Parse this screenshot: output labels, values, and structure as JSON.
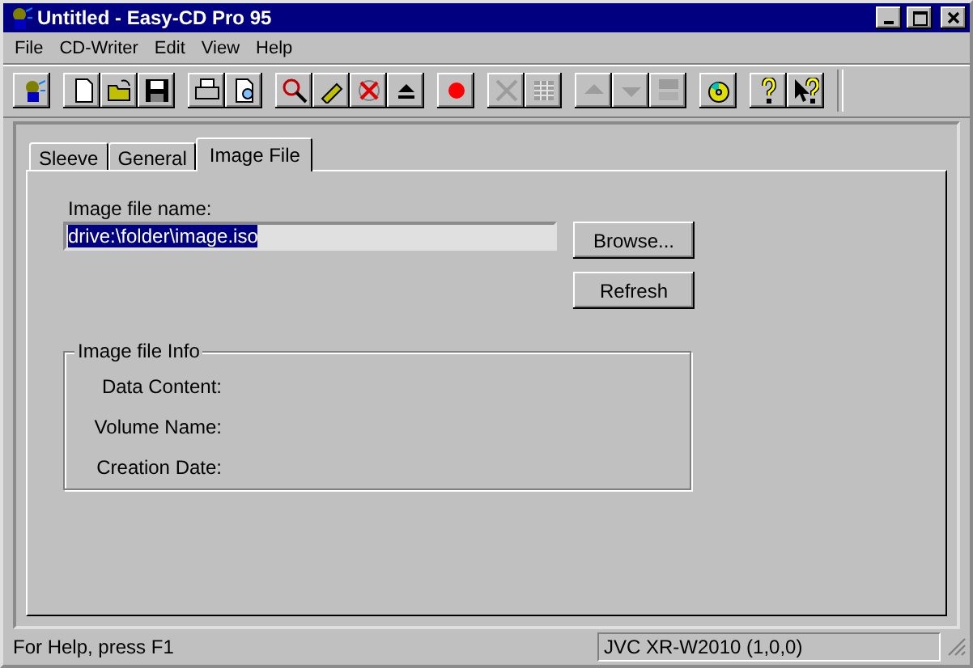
{
  "window": {
    "title": "Untitled - Easy-CD Pro 95"
  },
  "menu": [
    "File",
    "CD-Writer",
    "Edit",
    "View",
    "Help"
  ],
  "toolbar": [
    {
      "buttons": [
        {
          "disabled": false
        }
      ]
    },
    {
      "buttons": [
        {
          "disabled": false
        },
        {
          "disabled": false
        },
        {
          "disabled": false
        }
      ]
    },
    {
      "buttons": [
        {
          "disabled": false
        },
        {
          "disabled": false
        }
      ]
    },
    {
      "buttons": [
        {
          "disabled": false
        },
        {
          "disabled": false
        },
        {
          "disabled": false
        },
        {
          "disabled": false
        }
      ]
    },
    {
      "buttons": [
        {
          "disabled": false
        }
      ]
    },
    {
      "buttons": [
        {
          "disabled": true
        },
        {
          "disabled": true
        }
      ]
    },
    {
      "buttons": [
        {
          "disabled": true
        },
        {
          "disabled": true
        },
        {
          "disabled": true
        }
      ]
    },
    {
      "buttons": [
        {
          "disabled": false
        }
      ]
    },
    {
      "buttons": [
        {
          "disabled": false
        },
        {
          "disabled": false
        }
      ]
    }
  ],
  "tabs": [
    {
      "label": "Sleeve",
      "selected": false
    },
    {
      "label": "General",
      "selected": false
    },
    {
      "label": "Image File",
      "selected": true
    }
  ],
  "image_file": {
    "label": "Image file name:",
    "value": "drive:\\folder\\image.iso",
    "buttons": [
      "Browse...",
      "Refresh"
    ]
  },
  "info": {
    "title": "Image file Info",
    "fields": [
      "Data Content:",
      "Volume Name:",
      "Creation Date:"
    ]
  },
  "status_bar": {
    "help": "For Help, press F1",
    "device": "JVC XR-W2010 (1,0,0)"
  }
}
